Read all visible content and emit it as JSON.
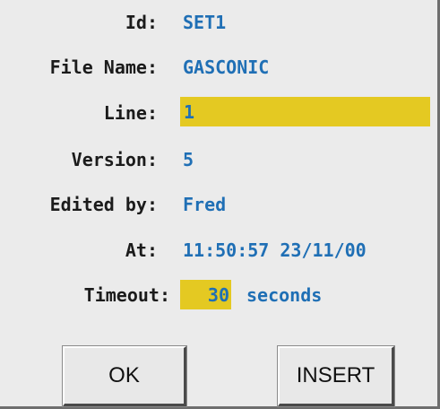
{
  "form": {
    "id_label": "Id:",
    "id_value": "SET1",
    "file_name_label": "File Name:",
    "file_name_value": "GASCONIC",
    "line_label": "Line:",
    "line_value": "1",
    "version_label": "Version:",
    "version_value": "5",
    "edited_by_label": "Edited by:",
    "edited_by_value": "Fred",
    "at_label": "At:",
    "at_value": "11:50:57 23/11/00",
    "timeout_label": "Timeout:",
    "timeout_value": "30",
    "timeout_unit": "seconds"
  },
  "buttons": {
    "ok_label": "OK",
    "insert_label": "INSERT"
  },
  "colors": {
    "background": "#ebebeb",
    "label_text": "#1b1b1b",
    "value_text": "#1f6fb5",
    "highlight": "#e4c922"
  }
}
